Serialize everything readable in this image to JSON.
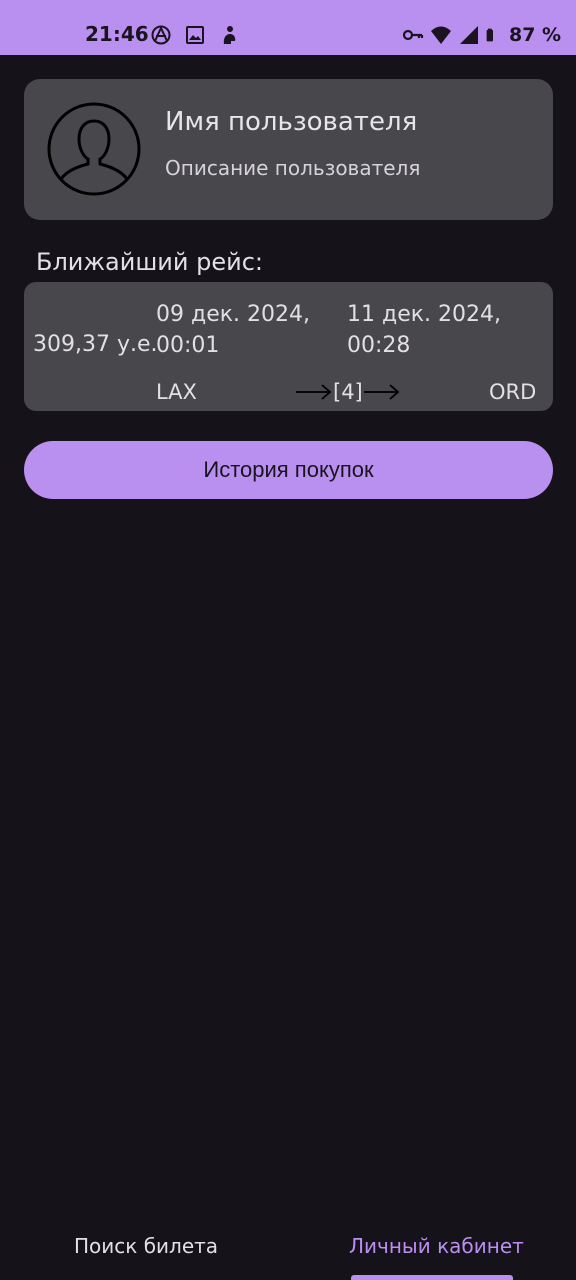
{
  "status_bar": {
    "time": "21:46",
    "battery_text": "87 %",
    "left_icons": [
      "anarchy-icon",
      "image-icon",
      "baby-icon"
    ],
    "right_icons": [
      "key-icon",
      "wifi-icon",
      "cell-signal-icon",
      "battery-icon"
    ]
  },
  "profile": {
    "name": "Имя пользователя",
    "description": "Описание пользователя",
    "avatar_icon": "user-avatar-icon"
  },
  "nearest_flight": {
    "label": "Ближайший рейс:",
    "price": "309,37 у.е.",
    "departure_date": "09 дек. 2024,",
    "departure_time": "00:01",
    "arrival_date": "11 дек. 2024,",
    "arrival_time": "00:28",
    "origin": "LAX",
    "destination": "ORD",
    "stops": "[4]"
  },
  "actions": {
    "history_label": "История покупок"
  },
  "bottom_nav": {
    "search_label": "Поиск билета",
    "profile_label": "Личный кабинет",
    "active": "profile"
  },
  "colors": {
    "accent": "#b98ff0",
    "background": "#15121a",
    "card": "#48474b"
  }
}
